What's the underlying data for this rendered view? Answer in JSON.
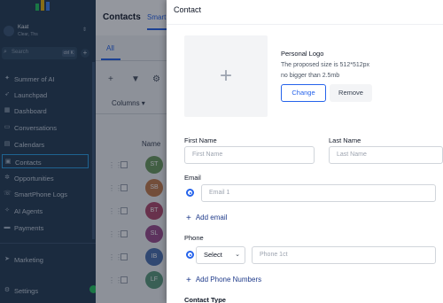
{
  "sidebar": {
    "account_name": "Kaat",
    "account_location": "Clear, Ths",
    "search_placeholder": "Search",
    "search_shortcut": "ctrl K",
    "items": [
      {
        "label": "Summer of AI",
        "icon": "sun-icon"
      },
      {
        "label": "Launchpad",
        "icon": "rocket-icon"
      },
      {
        "label": "Dashboard",
        "icon": "dashboard-icon"
      },
      {
        "label": "Conversations",
        "icon": "chat-icon"
      },
      {
        "label": "Calendars",
        "icon": "calendar-icon"
      },
      {
        "label": "Contacts",
        "icon": "contacts-icon",
        "active": true
      },
      {
        "label": "Opportunities",
        "icon": "opportunities-icon"
      },
      {
        "label": "SmartPhone Logs",
        "icon": "phone-icon"
      },
      {
        "label": "AI Agents",
        "icon": "ai-icon"
      },
      {
        "label": "Payments",
        "icon": "payments-icon"
      },
      {
        "label": "Marketing",
        "icon": "marketing-icon"
      },
      {
        "label": "Settings",
        "icon": "gear-icon"
      }
    ]
  },
  "main": {
    "title": "Contacts",
    "tab": "Smart",
    "list_tab": "All",
    "columns_label": "Columns",
    "name_header": "Name",
    "row_initials": [
      "ST",
      "SB",
      "BT",
      "SL",
      "IB",
      "LF"
    ],
    "row_colors": [
      "#6b9a5b",
      "#c47b4a",
      "#b0466a",
      "#9b4a8a",
      "#4a6fb0",
      "#5a9a7a"
    ]
  },
  "drawer": {
    "title": "Contact",
    "logo": {
      "title": "Personal Logo",
      "size_text": "The proposed size is 512*512px",
      "limit_text": "no bigger than 2.5mb",
      "change_label": "Change",
      "remove_label": "Remove"
    },
    "first_name": {
      "label": "First Name",
      "placeholder": "First Name"
    },
    "last_name": {
      "label": "Last Name",
      "placeholder": "Last Name"
    },
    "email": {
      "label": "Email",
      "placeholder": "Email 1",
      "add_label": "Add email"
    },
    "phone": {
      "label": "Phone",
      "select_value": "Select",
      "placeholder": "Phone 1ct",
      "add_label": "Add Phone Numbers"
    },
    "contact_type_label": "Contact Type"
  },
  "colors": {
    "accent": "#2563eb",
    "sidebar_bg": "#243b52",
    "active_outline": "#2aa0e8"
  }
}
